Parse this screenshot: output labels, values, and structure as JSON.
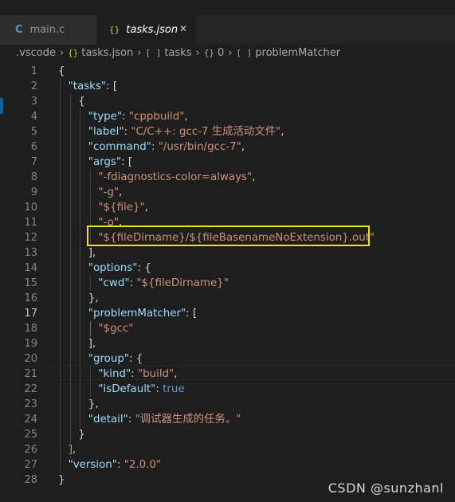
{
  "tabs": [
    {
      "icon": "C",
      "label": "main.c"
    },
    {
      "icon": "{}",
      "label": "tasks.json",
      "close": "✕"
    }
  ],
  "breadcrumb": [
    {
      "icon": "",
      "label": ".vscode"
    },
    {
      "icon": "{}",
      "label": "tasks.json"
    },
    {
      "icon": "[ ]",
      "label": "tasks"
    },
    {
      "icon": "{}",
      "label": "0"
    },
    {
      "icon": "[ ]",
      "label": "problemMatcher"
    }
  ],
  "active_line": 17,
  "lines": [
    [
      [
        "{",
        "p"
      ]
    ],
    [
      [
        "\"tasks\"",
        "k"
      ],
      [
        ": [",
        "p"
      ]
    ],
    [
      [
        "{",
        "p"
      ]
    ],
    [
      [
        "\"type\"",
        "k"
      ],
      [
        ": ",
        "p"
      ],
      [
        "\"cppbuild\"",
        "s"
      ],
      [
        ",",
        "p"
      ]
    ],
    [
      [
        "\"label\"",
        "k"
      ],
      [
        ": ",
        "p"
      ],
      [
        "\"C/C++: gcc-7 生成活动文件\"",
        "s"
      ],
      [
        ",",
        "p"
      ]
    ],
    [
      [
        "\"command\"",
        "k"
      ],
      [
        ": ",
        "p"
      ],
      [
        "\"/usr/bin/gcc-7\"",
        "s"
      ],
      [
        ",",
        "p"
      ]
    ],
    [
      [
        "\"args\"",
        "k"
      ],
      [
        ": [",
        "p"
      ]
    ],
    [
      [
        "\"-fdiagnostics-color=always\"",
        "s"
      ],
      [
        ",",
        "p"
      ]
    ],
    [
      [
        "\"-g\"",
        "s"
      ],
      [
        ",",
        "p"
      ]
    ],
    [
      [
        "\"${file}\"",
        "s"
      ],
      [
        ",",
        "p"
      ]
    ],
    [
      [
        "\"-o\"",
        "s"
      ],
      [
        ",",
        "p"
      ]
    ],
    [
      [
        "\"${fileDirname}/${fileBasenameNoExtension}.out\"",
        "s"
      ]
    ],
    [
      [
        "],",
        "p"
      ]
    ],
    [
      [
        "\"options\"",
        "k"
      ],
      [
        ": {",
        "p"
      ]
    ],
    [
      [
        "\"cwd\"",
        "k"
      ],
      [
        ": ",
        "p"
      ],
      [
        "\"${fileDirname}\"",
        "s"
      ]
    ],
    [
      [
        "},",
        "p"
      ]
    ],
    [
      [
        "\"problemMatcher\"",
        "k"
      ],
      [
        ": [",
        "p"
      ]
    ],
    [
      [
        "\"$gcc\"",
        "s"
      ]
    ],
    [
      [
        "],",
        "p"
      ]
    ],
    [
      [
        "\"group\"",
        "k"
      ],
      [
        ": {",
        "p"
      ]
    ],
    [
      [
        "\"kind\"",
        "k"
      ],
      [
        ": ",
        "p"
      ],
      [
        "\"build\"",
        "s"
      ],
      [
        ",",
        "p"
      ]
    ],
    [
      [
        "\"isDefault\"",
        "k"
      ],
      [
        ": ",
        "p"
      ],
      [
        "true",
        "b"
      ]
    ],
    [
      [
        "},",
        "p"
      ]
    ],
    [
      [
        "\"detail\"",
        "k"
      ],
      [
        ": ",
        "p"
      ],
      [
        "\"调试器生成的任务。\"",
        "s"
      ]
    ],
    [
      [
        "}",
        "p"
      ]
    ],
    [
      [
        "],",
        "p"
      ]
    ],
    [
      [
        "\"version\"",
        "k"
      ],
      [
        ": ",
        "p"
      ],
      [
        "\"2.0.0\"",
        "s"
      ]
    ],
    [
      [
        "}",
        "p"
      ]
    ]
  ],
  "watermark": "CSDN @sunzhanl"
}
